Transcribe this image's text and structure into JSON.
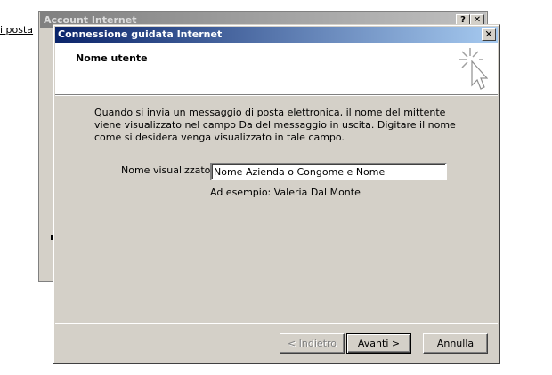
{
  "background": {
    "link_text": "i posta",
    "window_title": "Account Internet",
    "help_button": "?",
    "close_button": "✕"
  },
  "wizard": {
    "title": "Connessione guidata Internet",
    "close_button": "✕",
    "header_title": "Nome utente",
    "description": "Quando si invia un messaggio di posta elettronica, il nome del mittente viene visualizzato nel campo Da del messaggio in uscita. Digitare il nome come si desidera venga visualizzato in tale campo.",
    "display_name_label": "Nome visualizzato:",
    "display_name_value": "Nome Azienda o Congome e Nome",
    "example": "Ad esempio: Valeria Dal Monte",
    "buttons": {
      "back": "< Indietro",
      "next": "Avanti >",
      "cancel": "Annulla"
    }
  },
  "icons": {
    "wizard_icon": "cursor-sparkle-icon"
  }
}
